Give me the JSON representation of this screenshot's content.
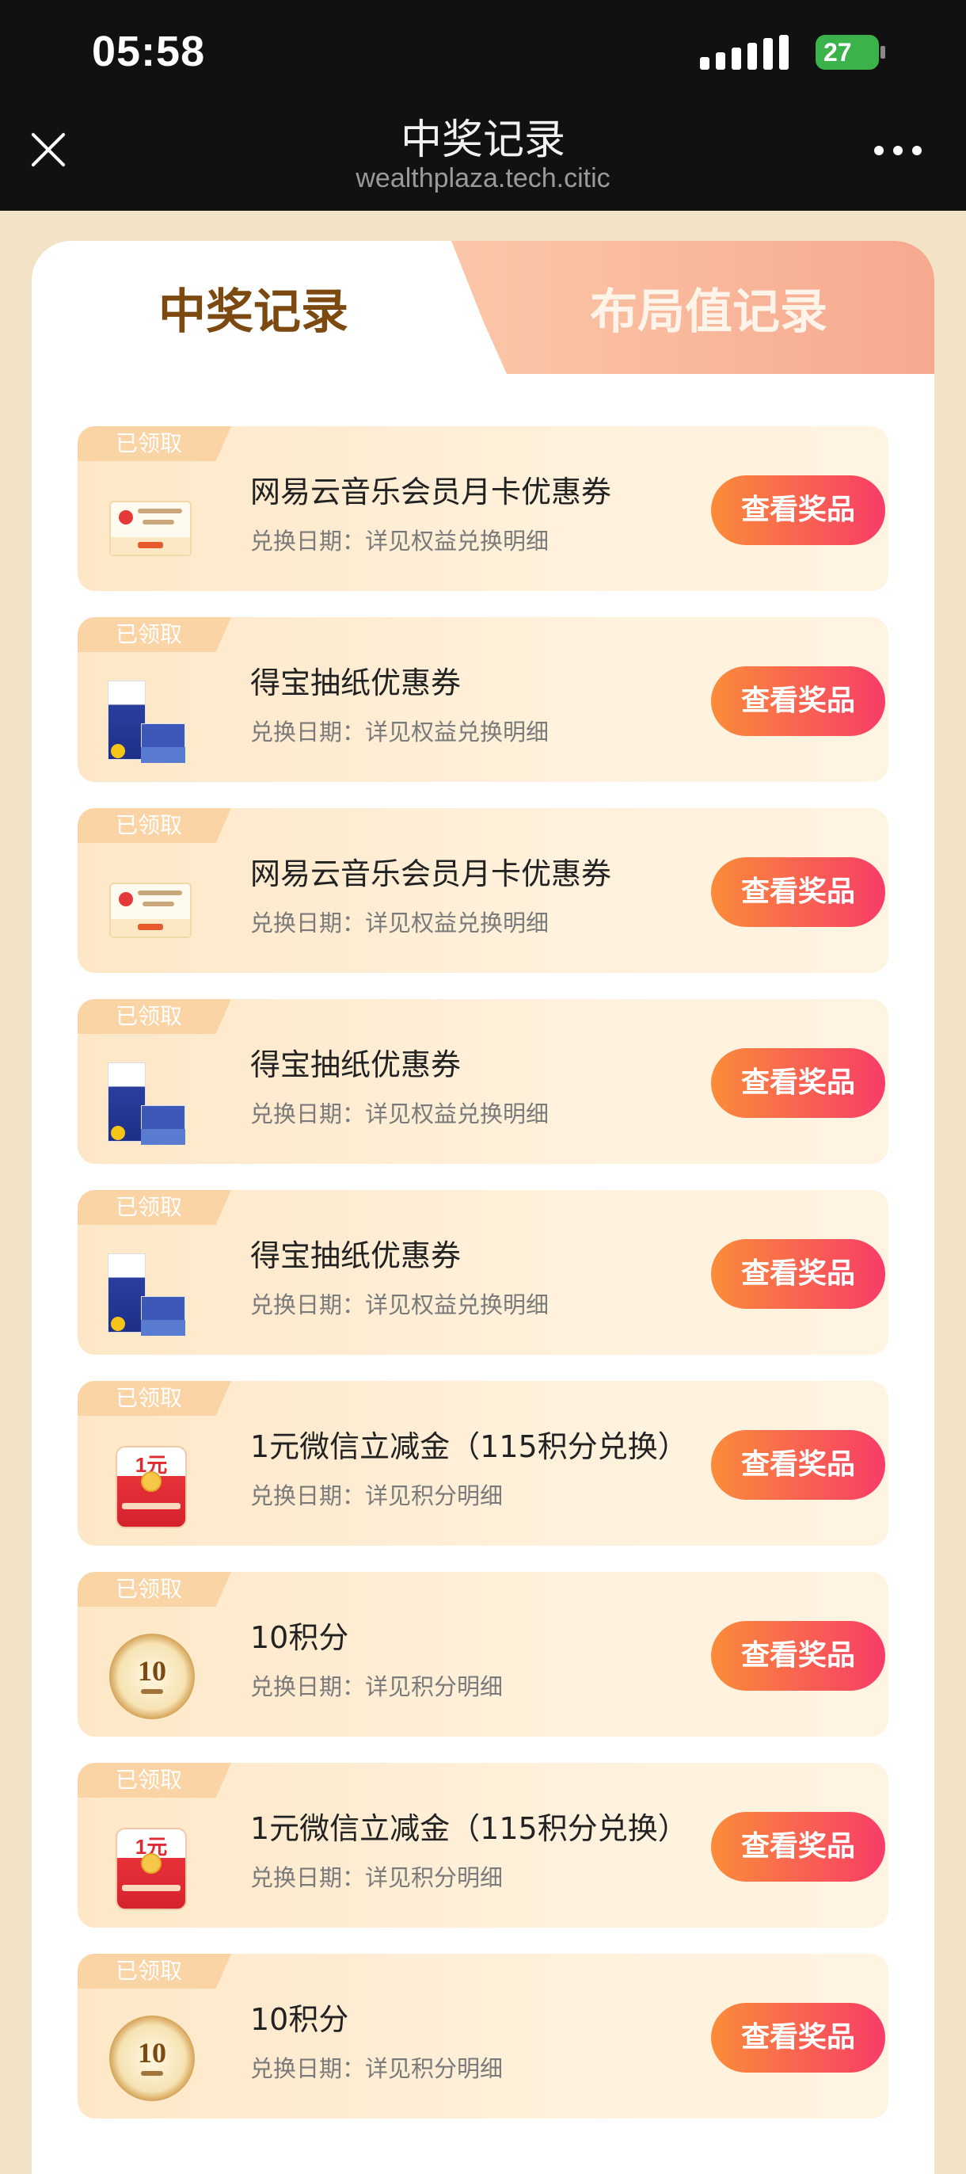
{
  "status_bar": {
    "time": "05:58",
    "battery": "27"
  },
  "nav": {
    "title": "中奖记录",
    "url": "wealthplaza.tech.citic"
  },
  "tabs": {
    "active": "中奖记录",
    "inactive": "布局值记录"
  },
  "items": [
    {
      "badge": "已领取",
      "thumb": "music-coupon",
      "title": "网易云音乐会员月卡优惠券",
      "date": "兑换日期：详见权益兑换明细",
      "button": "查看奖品"
    },
    {
      "badge": "已领取",
      "thumb": "tissue",
      "title": "得宝抽纸优惠券",
      "date": "兑换日期：详见权益兑换明细",
      "button": "查看奖品"
    },
    {
      "badge": "已领取",
      "thumb": "music-coupon",
      "title": "网易云音乐会员月卡优惠券",
      "date": "兑换日期：详见权益兑换明细",
      "button": "查看奖品"
    },
    {
      "badge": "已领取",
      "thumb": "tissue",
      "title": "得宝抽纸优惠券",
      "date": "兑换日期：详见权益兑换明细",
      "button": "查看奖品"
    },
    {
      "badge": "已领取",
      "thumb": "tissue",
      "title": "得宝抽纸优惠券",
      "date": "兑换日期：详见权益兑换明细",
      "button": "查看奖品"
    },
    {
      "badge": "已领取",
      "thumb": "red-packet",
      "title": "1元微信立减金（115积分兑换）",
      "date": "兑换日期：详见积分明细",
      "button": "查看奖品"
    },
    {
      "badge": "已领取",
      "thumb": "points-coin",
      "title": "10积分",
      "date": "兑换日期：详见积分明细",
      "button": "查看奖品"
    },
    {
      "badge": "已领取",
      "thumb": "red-packet",
      "title": "1元微信立减金（115积分兑换）",
      "date": "兑换日期：详见积分明细",
      "button": "查看奖品"
    },
    {
      "badge": "已领取",
      "thumb": "points-coin",
      "title": "10积分",
      "date": "兑换日期：详见积分明细",
      "button": "查看奖品"
    }
  ],
  "thumb_text": {
    "red_packet_amount": "1元",
    "coin_number": "10"
  },
  "colors": {
    "header_bg": "#111111",
    "page_bg": "#f3e3c6",
    "button_start": "#fb8c3a",
    "button_end": "#f73d66",
    "tab_active_text": "#7c4a10"
  }
}
